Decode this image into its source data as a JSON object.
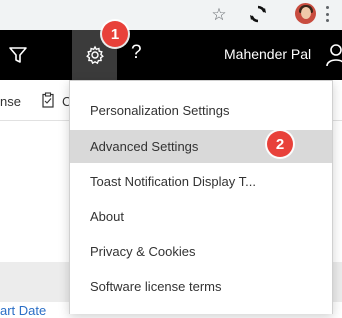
{
  "browser": {
    "star_icon": "☆",
    "sync_icon": "sync-icon",
    "profile_icon": "profile-avatar-icon",
    "menu_icon": "kebab-menu-icon"
  },
  "appbar": {
    "filter_icon": "filter-icon",
    "gear_icon": "gear-icon",
    "help_label": "?",
    "user_name": "Mahender Pal",
    "person_icon": "person-icon"
  },
  "callouts": {
    "one": "1",
    "two": "2"
  },
  "background": {
    "license_fragment": "nse",
    "co_fragment": "C",
    "start_date_fragment": "art Date"
  },
  "settings_menu": {
    "items": [
      {
        "label": "Personalization Settings"
      },
      {
        "label": "Advanced Settings"
      },
      {
        "label": "Toast Notification Display T..."
      },
      {
        "label": "About"
      },
      {
        "label": "Privacy & Cookies"
      },
      {
        "label": "Software license terms"
      }
    ]
  },
  "colors": {
    "appbar_bg": "#000000",
    "gear_button_bg": "#3b3b3b",
    "callout_red": "#e8413a",
    "highlight_bg": "#d9d9d9",
    "link_blue": "#2b6fc7"
  }
}
